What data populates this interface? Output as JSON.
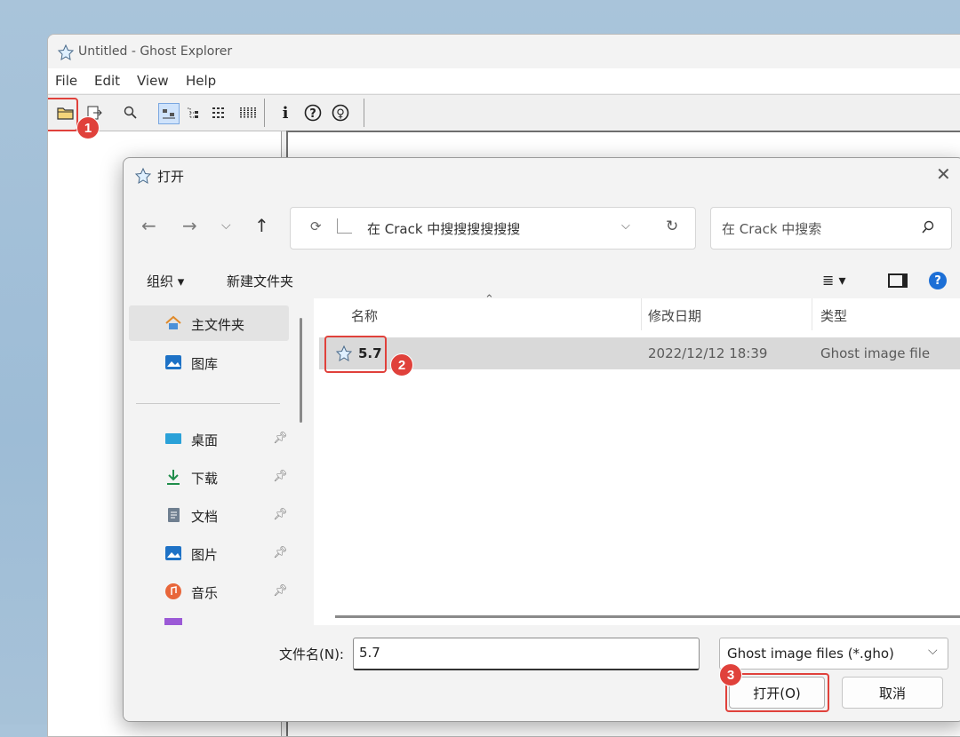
{
  "main_window": {
    "title": "Untitled - Ghost Explorer",
    "menu": [
      "File",
      "Edit",
      "View",
      "Help"
    ]
  },
  "dialog": {
    "title": "打开",
    "address": "在 Crack 中搜搜搜搜搜搜",
    "search_placeholder": "在 Crack 中搜索",
    "organize": "组织 ▾",
    "new_folder": "新建文件夹",
    "nav": {
      "home": "主文件夹",
      "gallery": "图库",
      "desktop": "桌面",
      "downloads": "下载",
      "documents": "文档",
      "pictures": "图片",
      "music": "音乐"
    },
    "columns": {
      "name": "名称",
      "date": "修改日期",
      "type": "类型"
    },
    "file": {
      "name": "5.7",
      "date": "2022/12/12 18:39",
      "type": "Ghost image file"
    },
    "filename_label": "文件名(N):",
    "filename_value": "5.7",
    "filetype": "Ghost image files (*.gho)",
    "open_button": "打开(O)",
    "cancel_button": "取消"
  },
  "callouts": [
    "1",
    "2",
    "3"
  ],
  "colors": {
    "callout": "#e0413b",
    "help_blue": "#1c6fd6"
  }
}
